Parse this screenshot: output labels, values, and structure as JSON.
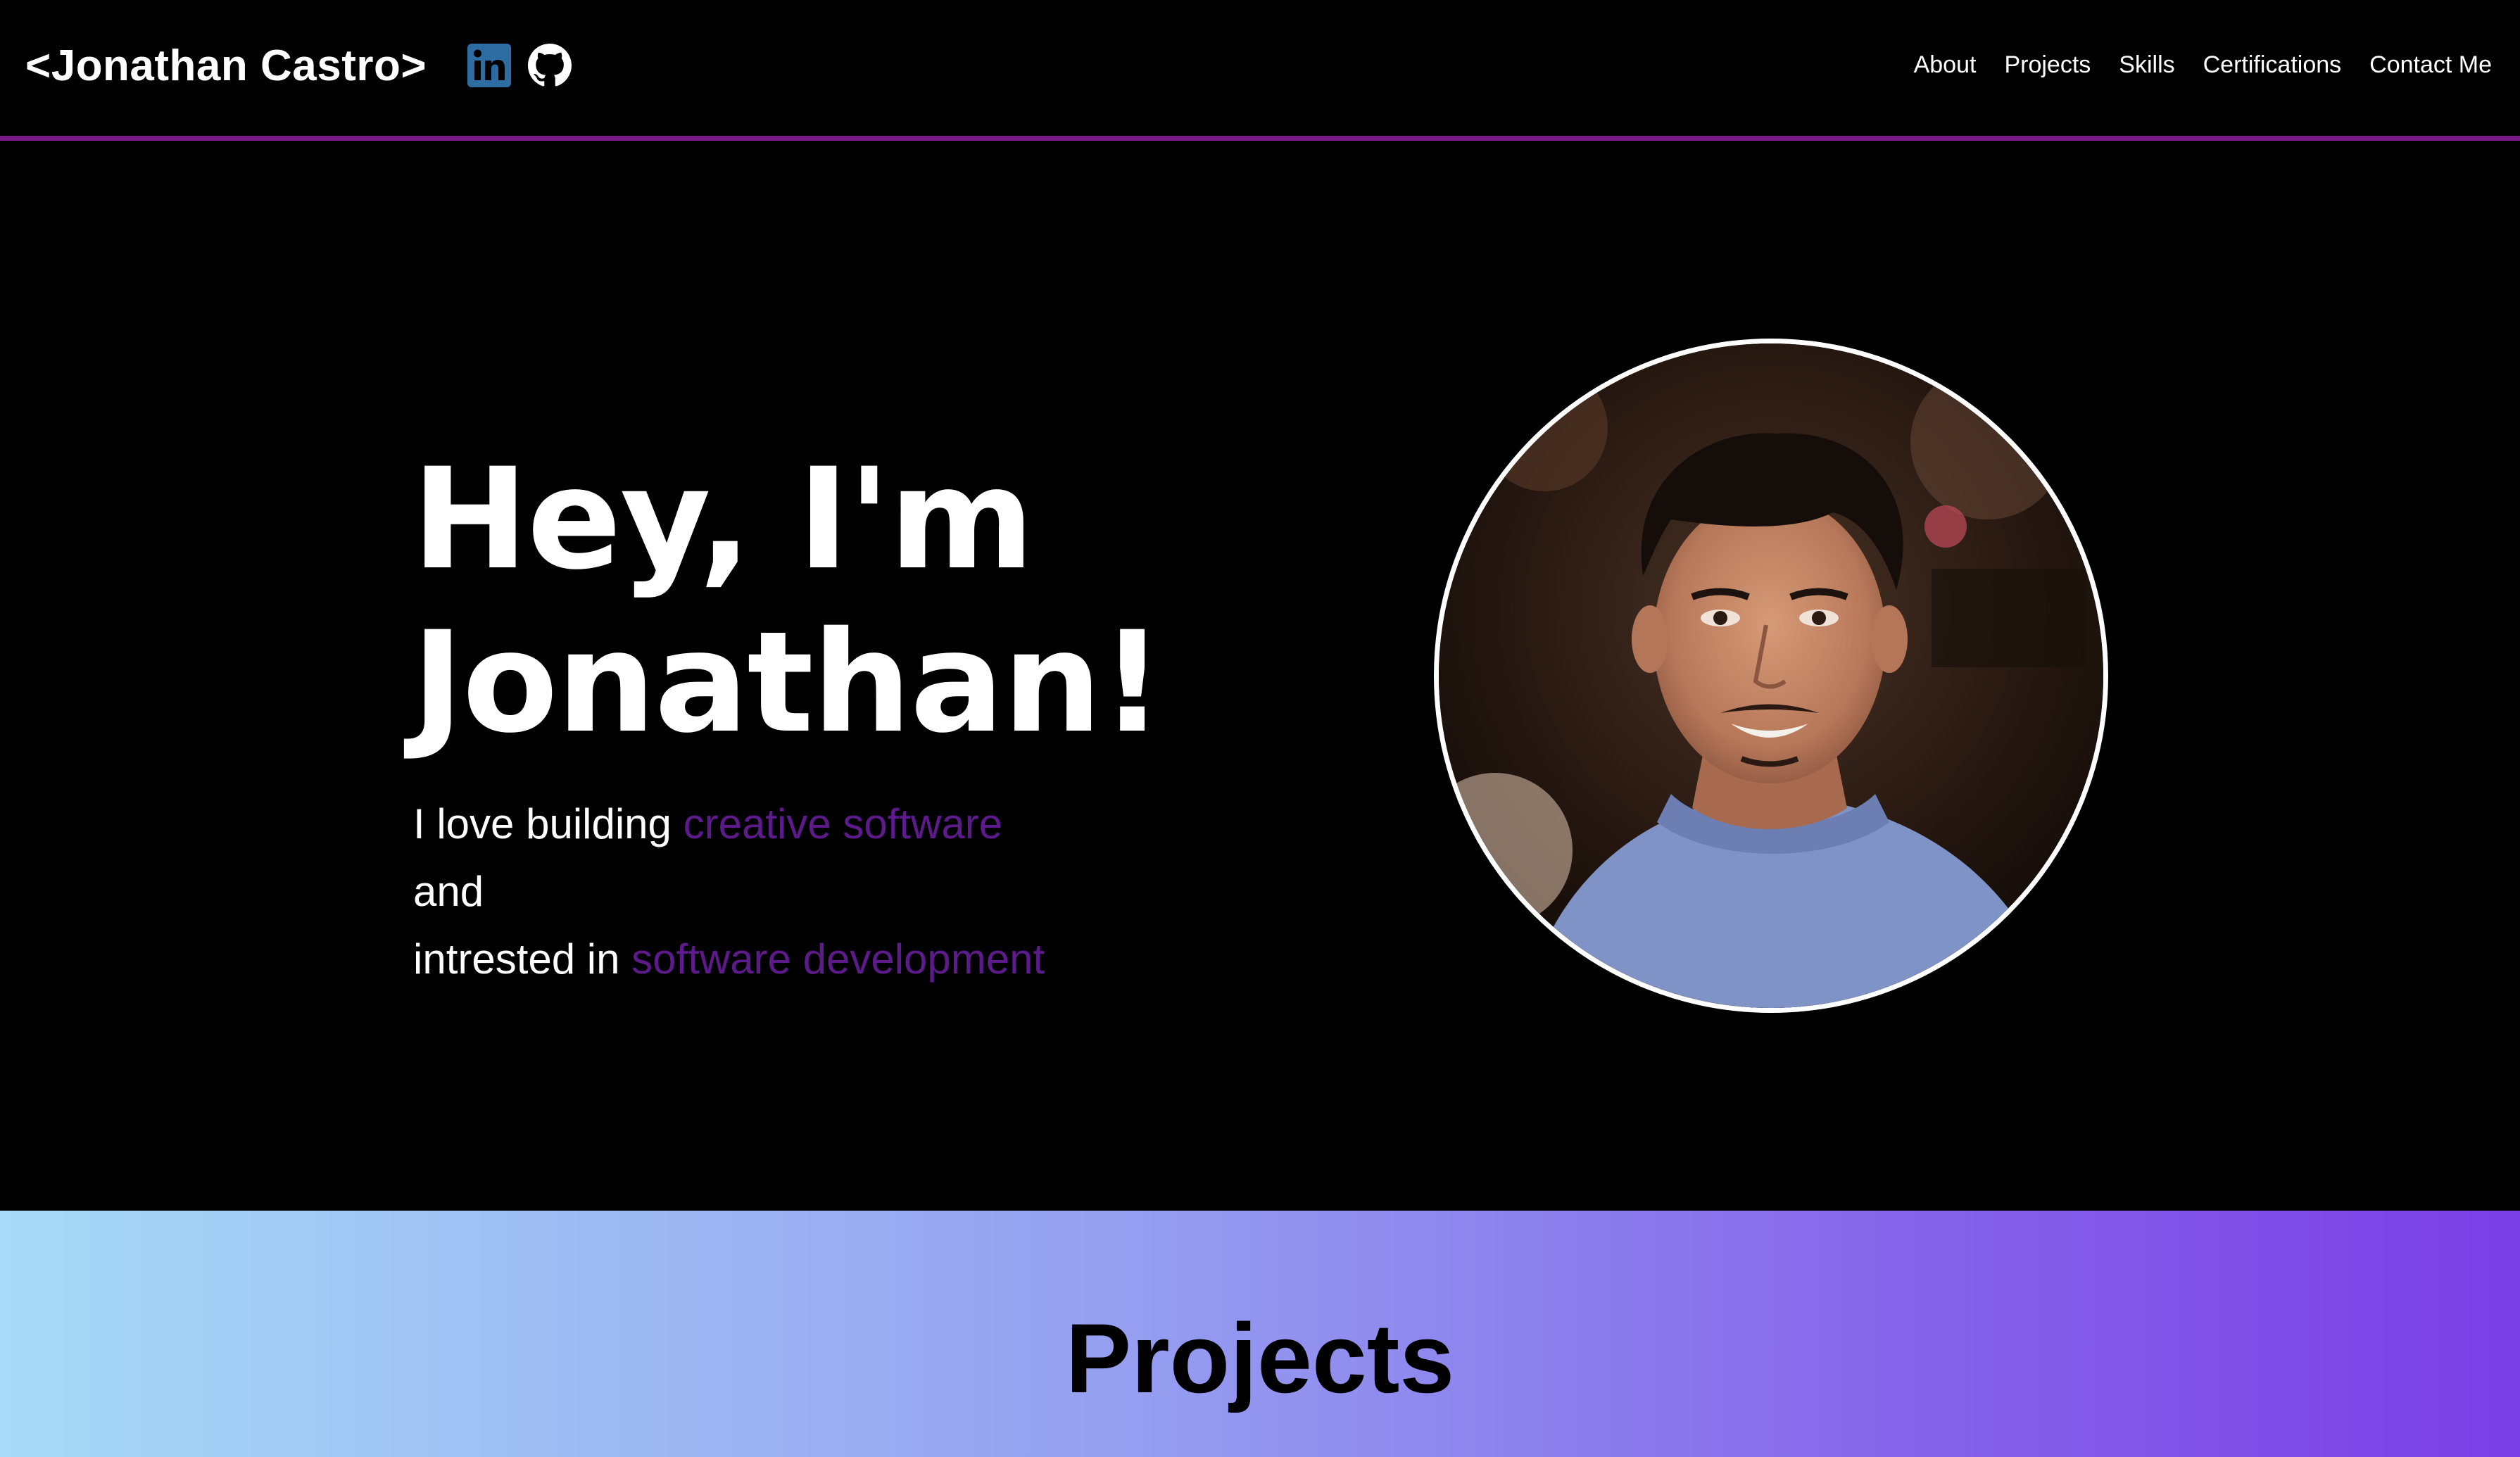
{
  "nav": {
    "brand": "<Jonathan Castro>",
    "social": [
      {
        "icon": "linkedin-icon",
        "color": "#2e6ca4"
      },
      {
        "icon": "github-icon",
        "color": "#ffffff"
      }
    ],
    "links": [
      "About",
      "Projects",
      "Skills",
      "Certifications",
      "Contact Me"
    ],
    "accent_border": "#7a1a86"
  },
  "hero": {
    "title_line1": "Hey, I'm",
    "title_line2": "Jonathan!",
    "sub_line1_prefix": "I love building ",
    "sub_line1_highlight": "creative software",
    "sub_line2": "and",
    "sub_line3_prefix": "intrested in ",
    "sub_line3_highlight": "software development",
    "highlight_color": "#5d1a8b",
    "avatar": "profile-photo"
  },
  "projects": {
    "heading": "Projects",
    "gradient": [
      "#a6daf6",
      "#7a3ee6"
    ]
  }
}
